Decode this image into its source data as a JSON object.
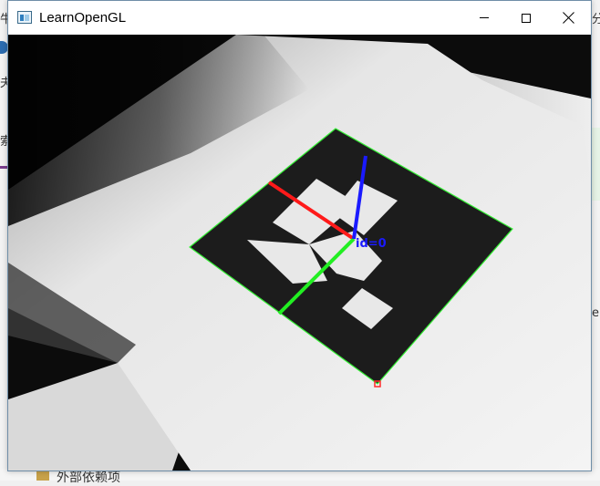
{
  "window": {
    "title": "LearnOpenGL",
    "controls": {
      "minimize": "minimize",
      "maximize": "maximize",
      "close": "close"
    }
  },
  "background": {
    "left_fragments": [
      "牛",
      "夫",
      "索"
    ],
    "right_fragments": [
      "分",
      "e"
    ],
    "bottom_fragment": "外部依赖项"
  },
  "scene": {
    "marker_label": "id=0",
    "axis_colors": {
      "x": "#ff1a1a",
      "y": "#22ee22",
      "z": "#1a1aff"
    },
    "outline_color": "#33ee33",
    "corner_marker_color": "#ff2a2a"
  }
}
